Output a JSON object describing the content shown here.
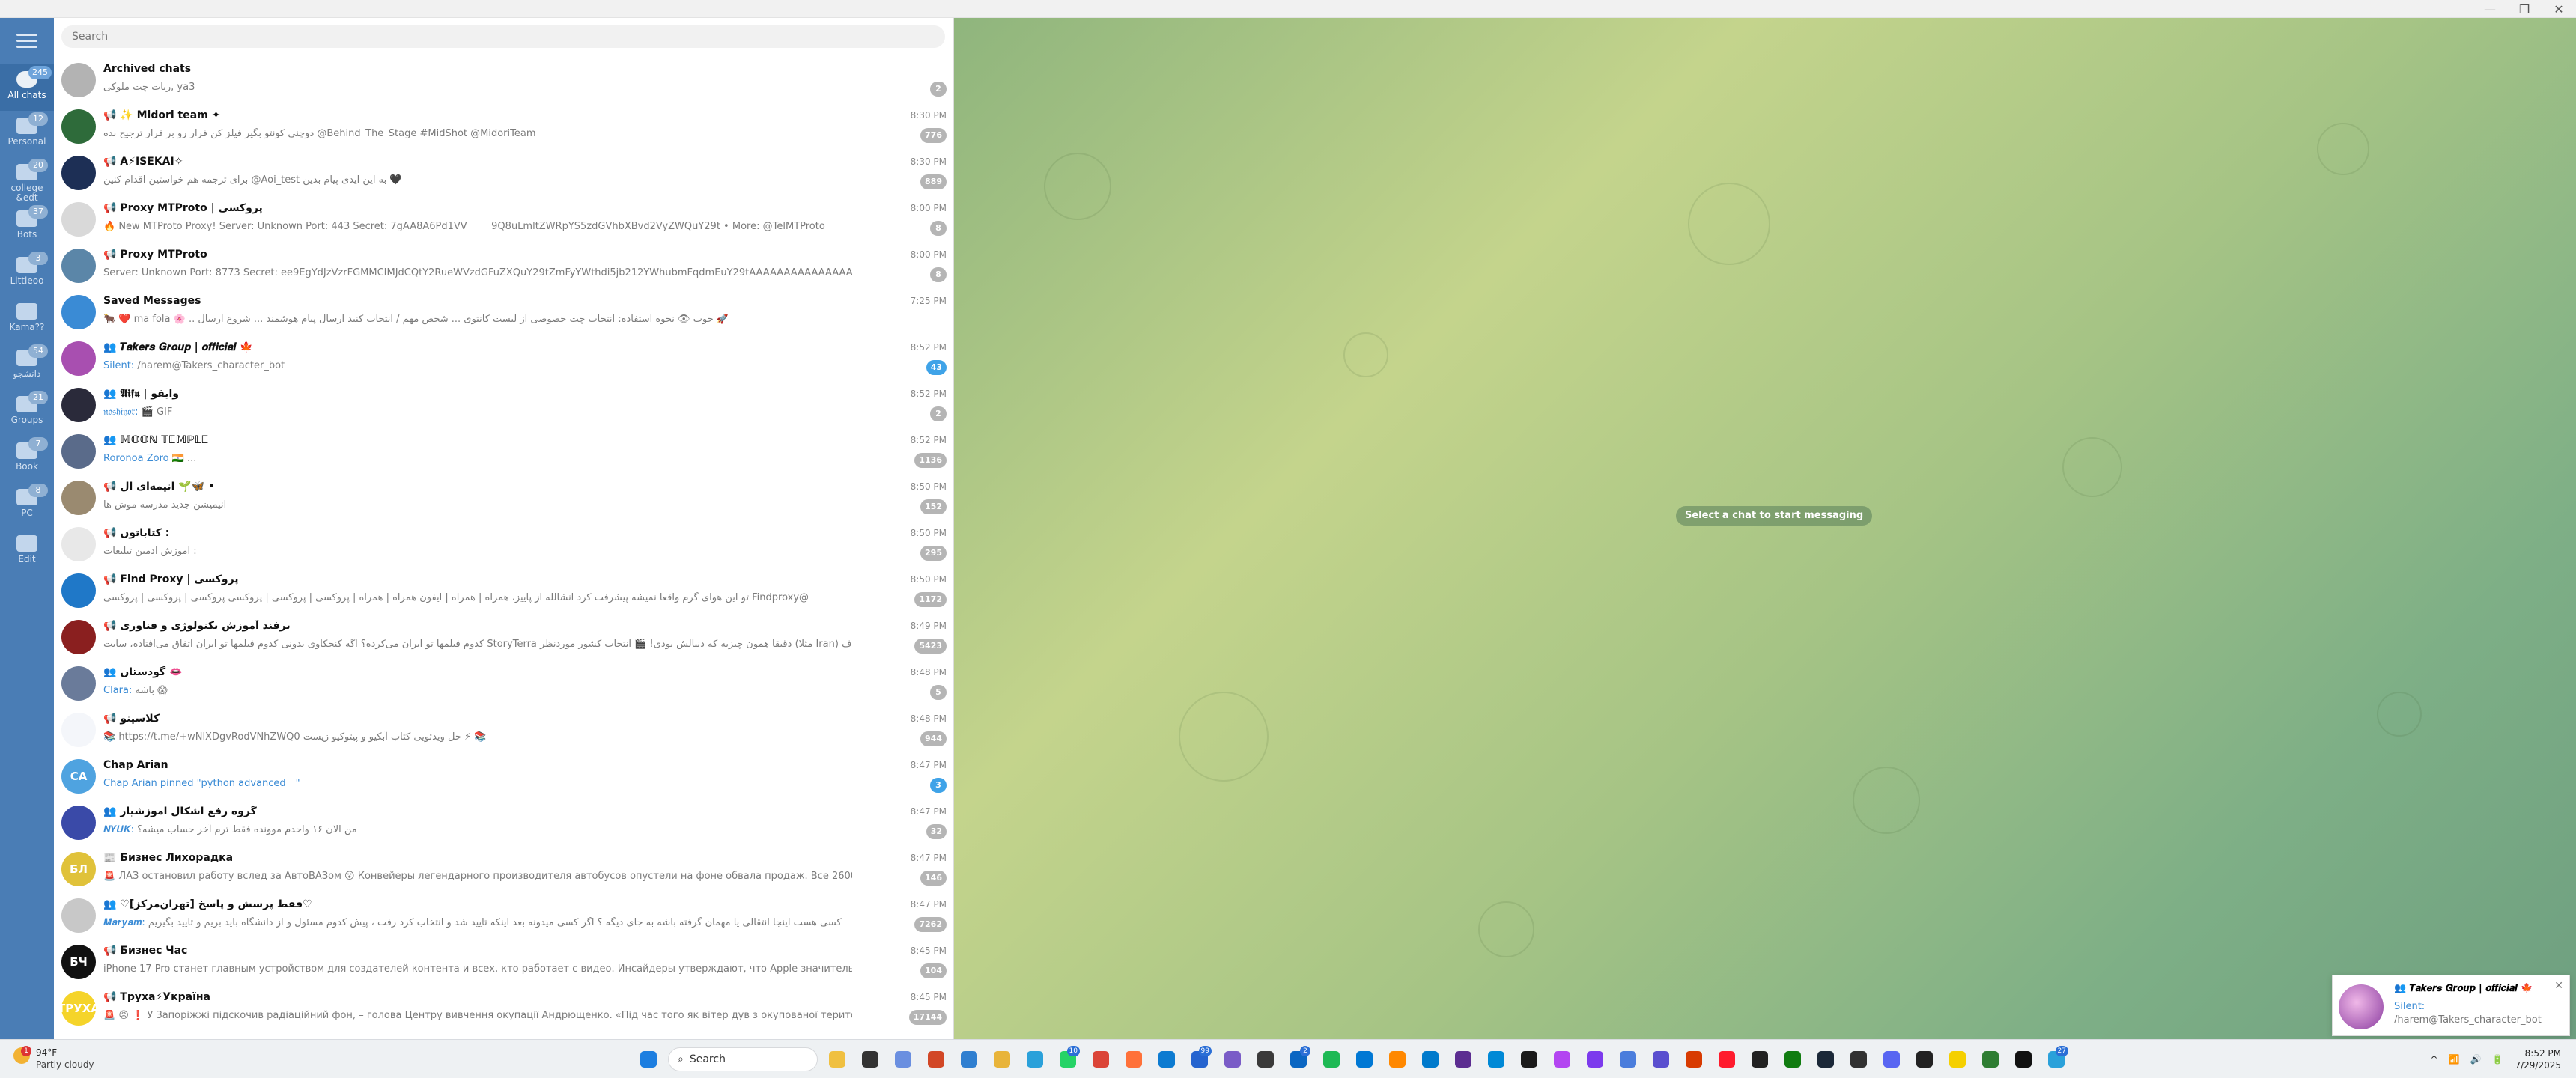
{
  "window": {
    "controls": [
      "—",
      "❐",
      "✕"
    ]
  },
  "folders": [
    {
      "label": "All chats",
      "badge": "245",
      "active": true
    },
    {
      "label": "Personal",
      "badge": "12"
    },
    {
      "label": "college &edt",
      "badge": "20"
    },
    {
      "label": "Bots",
      "badge": "37"
    },
    {
      "label": "Littleoo",
      "badge": "3"
    },
    {
      "label": "Kama??",
      "badge": ""
    },
    {
      "label": "دانشجو",
      "badge": "54"
    },
    {
      "label": "Groups",
      "badge": "21"
    },
    {
      "label": "Book",
      "badge": "7"
    },
    {
      "label": "PC",
      "badge": "8"
    },
    {
      "label": "Edit",
      "badge": ""
    }
  ],
  "search": {
    "placeholder": "Search"
  },
  "chats": [
    {
      "title": "Archived chats",
      "subtitle": "ربات چت ملوکی, ya3",
      "time": "",
      "badge": "2",
      "avatar_color": "#b3b3b3",
      "initials": ""
    },
    {
      "title": "📢 ✨ Midori team ✦",
      "subtitle": "دوچنی کونتو بگیر فیلز کن فرار رو بر قرار ترجیح بده @Behind_The_Stage #MidShot @MidoriTeam",
      "time": "8:30 PM",
      "badge": "776",
      "avatar_color": "#2e6b3a",
      "initials": ""
    },
    {
      "title": "📢 A⚡ISEKAI✧",
      "subtitle": "برای ترجمه هم خواستین اقدام کنین @Aoi_test به این ایدی پیام بدین 🖤",
      "time": "8:30 PM",
      "badge": "889",
      "avatar_color": "#1d2f55",
      "initials": ""
    },
    {
      "title": "📢 Proxy MTProto | پروکسی",
      "subtitle": "🔥 New MTProto Proxy! Server: Unknown Port: 443 Secret: 7gAA8A6Pd1VV_____9Q8uLmltZWRpYS5zdGVhbXBvd2VyZWQuY29t • More: @TelMTProto",
      "time": "8:00 PM",
      "badge": "8",
      "avatar_color": "#d9d9d9",
      "initials": ""
    },
    {
      "title": "📢 Proxy MTProto",
      "subtitle": "Server: Unknown Port: 8773 Secret: ee9EgYdJzVzrFGMMCIMJdCQtY2RueWVzdGFuZXQuY29tZmFyYWthdi5jb212YWhubmFqdmEuY29tAAAAAAAAAAAAAAAAAAAAAAAAAAA...",
      "time": "8:00 PM",
      "badge": "8",
      "avatar_color": "#5b86a8",
      "initials": ""
    },
    {
      "title": "Saved Messages",
      "subtitle": "🐂 ❤️ ma fola 🌸 .. خوب 👁 نحوه استفاده: انتخاب چت خصوصی از لیست کانتوی ... شخص مهم / انتخاب کنید ارسال پیام هوشمند ... شروع ارسال 🚀",
      "time": "7:25 PM",
      "badge": "",
      "avatar_color": "#3a8bd5",
      "initials": ""
    },
    {
      "title": "👥 𝑻𝒂𝒌𝒆𝒓𝒔 𝑮𝒓𝒐𝒖𝒑 | 𝒐𝒇𝒇𝒊𝒄𝒊𝒂𝒍 🍁",
      "subtitle_hl": "Silent:",
      "subtitle": " /harem@Takers_character_bot",
      "time": "8:52 PM",
      "badge": "43",
      "badge_blue": true,
      "avatar_color": "#a84fb0",
      "initials": ""
    },
    {
      "title": "👥 𝕬𝖎𝖋𝖚 | وایفو",
      "subtitle_hl": "𝔫𝔬𝔰𝔥𝔦𝔶𝔬𝔯:",
      "subtitle": " 🎬 GIF",
      "time": "8:52 PM",
      "badge": "2",
      "avatar_color": "#2a2a3a",
      "initials": ""
    },
    {
      "title": "👥 𝕄𝕆𝕆ℕ 𝕋𝔼𝕄ℙ𝕃𝔼",
      "subtitle_hl": "Roronoa Zoro",
      "subtitle": " 🇮🇳 ...",
      "time": "8:52 PM",
      "badge": "1136",
      "avatar_color": "#5a6b8a",
      "initials": ""
    },
    {
      "title": "📢 انیمه‌ای ال 🌱🦋 •",
      "subtitle": "انیمیشن جدید مدرسه موش ها",
      "time": "8:50 PM",
      "badge": "152",
      "avatar_color": "#9a8a70",
      "initials": ""
    },
    {
      "title": "📢 کتاباتون :",
      "subtitle": "آموزش ادمین تبلیغات :",
      "time": "8:50 PM",
      "badge": "295",
      "avatar_color": "#e8e8e8",
      "initials": ""
    },
    {
      "title": "📢 Find Proxy | پروکسی",
      "subtitle": "تو این هوای گرم واقعا نمیشه پیشرفت کرد انشالله از پاییز، همراه | همراه | ایفون همراه | همراه | پروکسی | پروکسی | پروکسی پروکسی | پروکسی | پروکسی Findproxy@",
      "time": "8:50 PM",
      "badge": "1172",
      "avatar_color": "#1f78c8",
      "initials": ""
    },
    {
      "title": "📢 ترفند آموزش تکنولوژی و فناوری",
      "subtitle": "کدوم فیلمها تو ایران می‌کرده؟ اگه کنجکاوی بدونی کدوم فیلمها تو ایران اتفاق می‌افتاده، سایت StoryTerra دقیقاً همون چیزیه که دنبالش بودی! 🎬 انتخاب کشور موردنظر (مثلا Iran) لیست کامل، از ف...",
      "time": "8:49 PM",
      "badge": "5423",
      "avatar_color": "#8a1f1f",
      "initials": ""
    },
    {
      "title": "👥 گودستان 👄",
      "subtitle_hl": "Clara:",
      "subtitle": " باشه 😱",
      "time": "8:48 PM",
      "badge": "5",
      "avatar_color": "#6a7b9a",
      "initials": ""
    },
    {
      "title": "📢 کلاسینو",
      "subtitle": "📚 https://t.me/+wNlXDgvRodVNhZWQ0 حل ویدئویی کتاب آبکیو و پیتوکیو زیست ⚡ 📚",
      "time": "8:48 PM",
      "badge": "944",
      "avatar_color": "#f4f6fa",
      "initials": ""
    },
    {
      "title": "Chap Arian",
      "subtitle_hl": "Chap Arian pinned \"python advanced__\"",
      "subtitle": "",
      "time": "8:47 PM",
      "badge": "3",
      "badge_blue": true,
      "avatar_color": "#4fa3e0",
      "initials": "CA"
    },
    {
      "title": "👥 گروه رفع اشکال آموزشیار",
      "subtitle_hl": "𝑵𝒀𝑼𝑲:",
      "subtitle": " من الان ۱۶ واحدم موونده فقط ترم آخر حساب میشه؟",
      "time": "8:47 PM",
      "badge": "32",
      "avatar_color": "#3a4aa8",
      "initials": ""
    },
    {
      "title": "📰 Бизнес Лихорадка",
      "subtitle": "🚨 ЛАЗ остановил работу вслед за АвтоВАЗом 😮 Конвейеры легендарного производителя автобусов опустели на фоне обвала продаж. Все 2600 сотрудников находятс...",
      "time": "8:47 PM",
      "badge": "146",
      "avatar_color": "#e0c23a",
      "initials": "БЛ"
    },
    {
      "title": "👥 ♡فقط پرسش و پاسخ [تهران‌مرکز]♡",
      "subtitle_hl": "𝑴𝒂𝒓𝒚𝒂𝒎:",
      "subtitle": " کسی هست اینجا انتقالی یا مهمان گرفته باشه به جای دیگه ؟ اگر کسی میدونه بعد اینکه تایید شد و انتخاب کرد رفت ، پیش کدوم مسئول و از دانشگاه باید بریم و تایید بگیریم",
      "time": "8:47 PM",
      "badge": "7262",
      "avatar_color": "#c8c8c8",
      "initials": ""
    },
    {
      "title": "📢 Бизнес Час",
      "subtitle": "iPhone 17 Pro станет главным устройством для создателей контента и всех, кто работает с видео. Инсайдеры утверждают, что Apple значительно улучшит камеру, он...",
      "time": "8:45 PM",
      "badge": "104",
      "avatar_color": "#111111",
      "initials": "БЧ"
    },
    {
      "title": "📢 Труха⚡Україна",
      "subtitle": "🚨 😡 ❗ У Запоріжжі підскочив радіаційний фон, – голова Центру вивчення окупації Андрющенко. «Під час того як вітер дув з окупованої території, піднімався рівень ви...",
      "time": "8:45 PM",
      "badge": "17144",
      "avatar_color": "#f5d42a",
      "initials": "ТРУХА"
    }
  ],
  "chat_area": {
    "placeholder_pill": "Select a chat to start messaging"
  },
  "notification": {
    "title": "👥 𝑻𝒂𝒌𝒆𝒓𝒔 𝑮𝒓𝒐𝒖𝒑 | 𝒐𝒇𝒇𝒊𝒄𝒊𝒂𝒍 🍁",
    "line1": "Silent:",
    "line2": "/harem@Takers_character_bot"
  },
  "taskbar": {
    "weather_temp": "94°F",
    "weather_desc": "Partly cloudy",
    "weather_badge": "1",
    "search_label": "Search",
    "apps": [
      {
        "name": "windows-start",
        "color": "#1c7ee0"
      },
      {
        "name": "file-explorer",
        "color": "#f0c040"
      },
      {
        "name": "terminal",
        "color": "#333333"
      },
      {
        "name": "copilot",
        "color": "#6a8fe0"
      },
      {
        "name": "office",
        "color": "#d24726"
      },
      {
        "name": "store",
        "color": "#2f7fd0"
      },
      {
        "name": "folder",
        "color": "#e8b43a"
      },
      {
        "name": "telegram",
        "color": "#2aa1da"
      },
      {
        "name": "whatsapp",
        "color": "#25d366",
        "badge": "10"
      },
      {
        "name": "chrome",
        "color": "#db4437"
      },
      {
        "name": "firefox",
        "color": "#ff7139"
      },
      {
        "name": "edge",
        "color": "#0c7bd1"
      },
      {
        "name": "todo",
        "color": "#2564cf",
        "badge": "99"
      },
      {
        "name": "snipping",
        "color": "#7a5cc7"
      },
      {
        "name": "calculator",
        "color": "#3a3a3a"
      },
      {
        "name": "linkedin",
        "color": "#0a66c2",
        "badge": "2"
      },
      {
        "name": "spotify",
        "color": "#1db954"
      },
      {
        "name": "mail",
        "color": "#0078d4"
      },
      {
        "name": "vlc",
        "color": "#ff8800"
      },
      {
        "name": "vscode",
        "color": "#007acc"
      },
      {
        "name": "visual-studio",
        "color": "#5c2d91"
      },
      {
        "name": "azure",
        "color": "#0089d6"
      },
      {
        "name": "pycharm",
        "color": "#1a1a1a"
      },
      {
        "name": "phpstorm",
        "color": "#b345f1"
      },
      {
        "name": "obsidian",
        "color": "#7c3aed"
      },
      {
        "name": "maps",
        "color": "#4a7ddc"
      },
      {
        "name": "mail-client",
        "color": "#5a4fcf"
      },
      {
        "name": "media",
        "color": "#d83b01"
      },
      {
        "name": "opera",
        "color": "#ff1b2d"
      },
      {
        "name": "notes",
        "color": "#222222"
      },
      {
        "name": "xbox",
        "color": "#107c10"
      },
      {
        "name": "steam",
        "color": "#1b2838"
      },
      {
        "name": "epic",
        "color": "#313131"
      },
      {
        "name": "discord",
        "color": "#5865f2"
      },
      {
        "name": "app-dark",
        "color": "#222222"
      },
      {
        "name": "notes-yellow",
        "color": "#f5d000"
      },
      {
        "name": "app-green",
        "color": "#2e7d32"
      },
      {
        "name": "cmd",
        "color": "#111111"
      },
      {
        "name": "telegram-active",
        "color": "#2aa1da",
        "badge": "27"
      }
    ],
    "tray_icons": [
      "^",
      "📶",
      "🔊",
      "🔋"
    ],
    "time": "8:52 PM",
    "date": "7/29/2025"
  }
}
